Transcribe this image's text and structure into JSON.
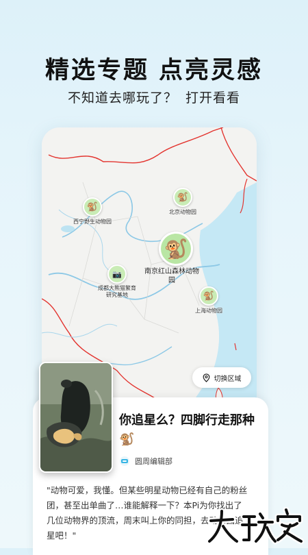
{
  "header": {
    "title_a": "精选专题",
    "title_b": "点亮灵感",
    "sub_a": "不知道去哪玩了？",
    "sub_b": "打开看看"
  },
  "map": {
    "pois": [
      {
        "label": "西宁野生动物园",
        "icon": "monkey-icon"
      },
      {
        "label": "北京动物园",
        "icon": "monkey-icon"
      },
      {
        "label": "南京红山森林动物园",
        "icon": "monkey-icon"
      },
      {
        "label": "成都大熊猫繁育研究基地",
        "icon": "camera-icon"
      },
      {
        "label": "上海动物园",
        "icon": "monkey-icon"
      }
    ],
    "switch_label": "切换区域"
  },
  "article": {
    "title": "你追星么？四脚行走那种",
    "title_emoji": "🐒",
    "author": "圆周编辑部",
    "excerpt": "\"动物可爱，我懂。但某些明星动物已经有自己的粉丝团，甚至出单曲了…谁能解释一下？本Pi为你找出了几位动物界的顶流，周末叫上你的同担，去动物园追星吧！\""
  },
  "watermark": {
    "text": "大玩家"
  },
  "colors": {
    "poi_green": "#c9ecb6",
    "border_red": "#e3342f",
    "water": "#bde3f2",
    "river": "#8cc8e6"
  }
}
